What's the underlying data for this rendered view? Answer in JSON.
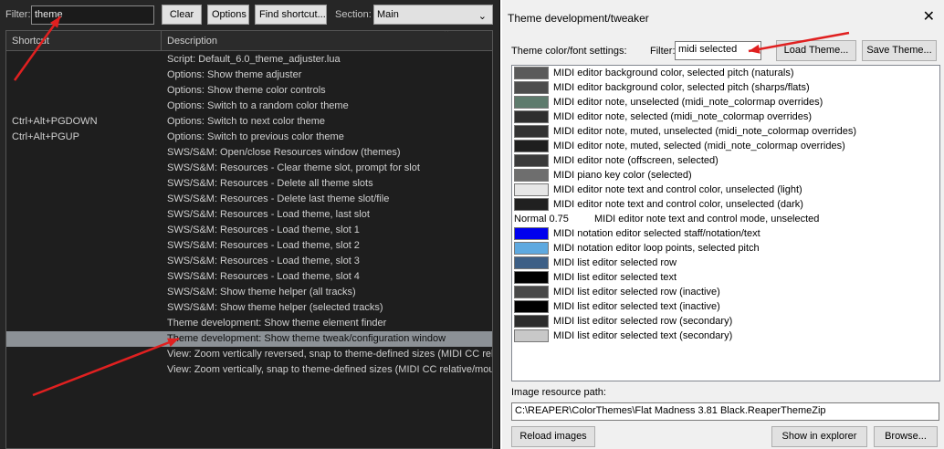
{
  "actions": {
    "filter_label": "Filter:",
    "filter_value": "theme",
    "clear_label": "Clear",
    "options_label": "Options",
    "find_shortcut_label": "Find shortcut...",
    "section_label": "Section:",
    "section_value": "Main",
    "col_shortcut": "Shortcut",
    "col_description": "Description",
    "rows": [
      {
        "shortcut": "",
        "desc": "Script: Default_6.0_theme_adjuster.lua"
      },
      {
        "shortcut": "",
        "desc": "Options: Show theme adjuster"
      },
      {
        "shortcut": "",
        "desc": "Options: Show theme color controls"
      },
      {
        "shortcut": "",
        "desc": "Options: Switch to a random color theme"
      },
      {
        "shortcut": "Ctrl+Alt+PGDOWN",
        "desc": "Options: Switch to next color theme"
      },
      {
        "shortcut": "Ctrl+Alt+PGUP",
        "desc": "Options: Switch to previous color theme"
      },
      {
        "shortcut": "",
        "desc": "SWS/S&M: Open/close Resources window (themes)"
      },
      {
        "shortcut": "",
        "desc": "SWS/S&M: Resources - Clear theme slot, prompt for slot"
      },
      {
        "shortcut": "",
        "desc": "SWS/S&M: Resources - Delete all theme slots"
      },
      {
        "shortcut": "",
        "desc": "SWS/S&M: Resources - Delete last theme slot/file"
      },
      {
        "shortcut": "",
        "desc": "SWS/S&M: Resources - Load theme, last slot"
      },
      {
        "shortcut": "",
        "desc": "SWS/S&M: Resources - Load theme, slot 1"
      },
      {
        "shortcut": "",
        "desc": "SWS/S&M: Resources - Load theme, slot 2"
      },
      {
        "shortcut": "",
        "desc": "SWS/S&M: Resources - Load theme, slot 3"
      },
      {
        "shortcut": "",
        "desc": "SWS/S&M: Resources - Load theme, slot 4"
      },
      {
        "shortcut": "",
        "desc": "SWS/S&M: Show theme helper (all tracks)"
      },
      {
        "shortcut": "",
        "desc": "SWS/S&M: Show theme helper (selected tracks)"
      },
      {
        "shortcut": "",
        "desc": "Theme development: Show theme element finder"
      },
      {
        "shortcut": "",
        "desc": "Theme development: Show theme tweak/configuration window",
        "selected": true
      },
      {
        "shortcut": "",
        "desc": "View: Zoom vertically reversed, snap to theme-defined sizes (MIDI CC relative/mousewheel)"
      },
      {
        "shortcut": "",
        "desc": "View: Zoom vertically, snap to theme-defined sizes (MIDI CC relative/mousewheel)"
      }
    ]
  },
  "tweaker": {
    "title": "Theme development/tweaker",
    "close_glyph": "✕",
    "settings_label": "Theme color/font settings:",
    "filter_label": "Filter:",
    "filter_value": "midi selected",
    "load_theme_label": "Load Theme...",
    "save_theme_label": "Save Theme...",
    "items": [
      {
        "color": "#5a5a5a",
        "text": "MIDI editor background color, selected pitch (naturals)"
      },
      {
        "color": "#4d4d4d",
        "text": "MIDI editor background color, selected pitch (sharps/flats)"
      },
      {
        "color": "#5e7b6d",
        "text": "MIDI editor note, unselected (midi_note_colormap overrides)"
      },
      {
        "color": "#2f2f2f",
        "text": "MIDI editor note, selected (midi_note_colormap overrides)"
      },
      {
        "color": "#333333",
        "text": "MIDI editor note, muted, unselected (midi_note_colormap overrides)"
      },
      {
        "color": "#1e1e1e",
        "text": "MIDI editor note, muted, selected (midi_note_colormap overrides)"
      },
      {
        "color": "#3a3a3a",
        "text": "MIDI editor note (offscreen, selected)"
      },
      {
        "color": "#6e6e6e",
        "text": "MIDI piano key color (selected)"
      },
      {
        "color": "#e6e6e6",
        "text": "MIDI editor note text and control color, unselected (light)"
      },
      {
        "color": "#202020",
        "text": "MIDI editor note text and control color, unselected (dark)"
      },
      {
        "value": "Normal 0.75",
        "text": "MIDI editor note text and control mode, unselected"
      },
      {
        "color": "#0000ee",
        "text": "MIDI notation editor selected staff/notation/text"
      },
      {
        "color": "#5ea9e0",
        "text": "MIDI notation editor loop points, selected pitch"
      },
      {
        "color": "#3d5f86",
        "text": "MIDI list editor selected row"
      },
      {
        "color": "#000000",
        "text": "MIDI list editor selected text"
      },
      {
        "color": "#484848",
        "text": "MIDI list editor selected row (inactive)"
      },
      {
        "color": "#000000",
        "text": "MIDI list editor selected text (inactive)"
      },
      {
        "color": "#2c2c2c",
        "text": "MIDI list editor selected row (secondary)"
      },
      {
        "color": "#c8c8c8",
        "text": "MIDI list editor selected text (secondary)"
      }
    ],
    "image_path_label": "Image resource path:",
    "image_path_value": "C:\\REAPER\\ColorThemes\\Flat Madness 3.81 Black.ReaperThemeZip",
    "reload_images_label": "Reload images",
    "show_in_explorer_label": "Show in explorer",
    "browse_label": "Browse..."
  },
  "colors": {
    "annotation_arrow": "#e02020",
    "selected_row": "#8c9196"
  }
}
